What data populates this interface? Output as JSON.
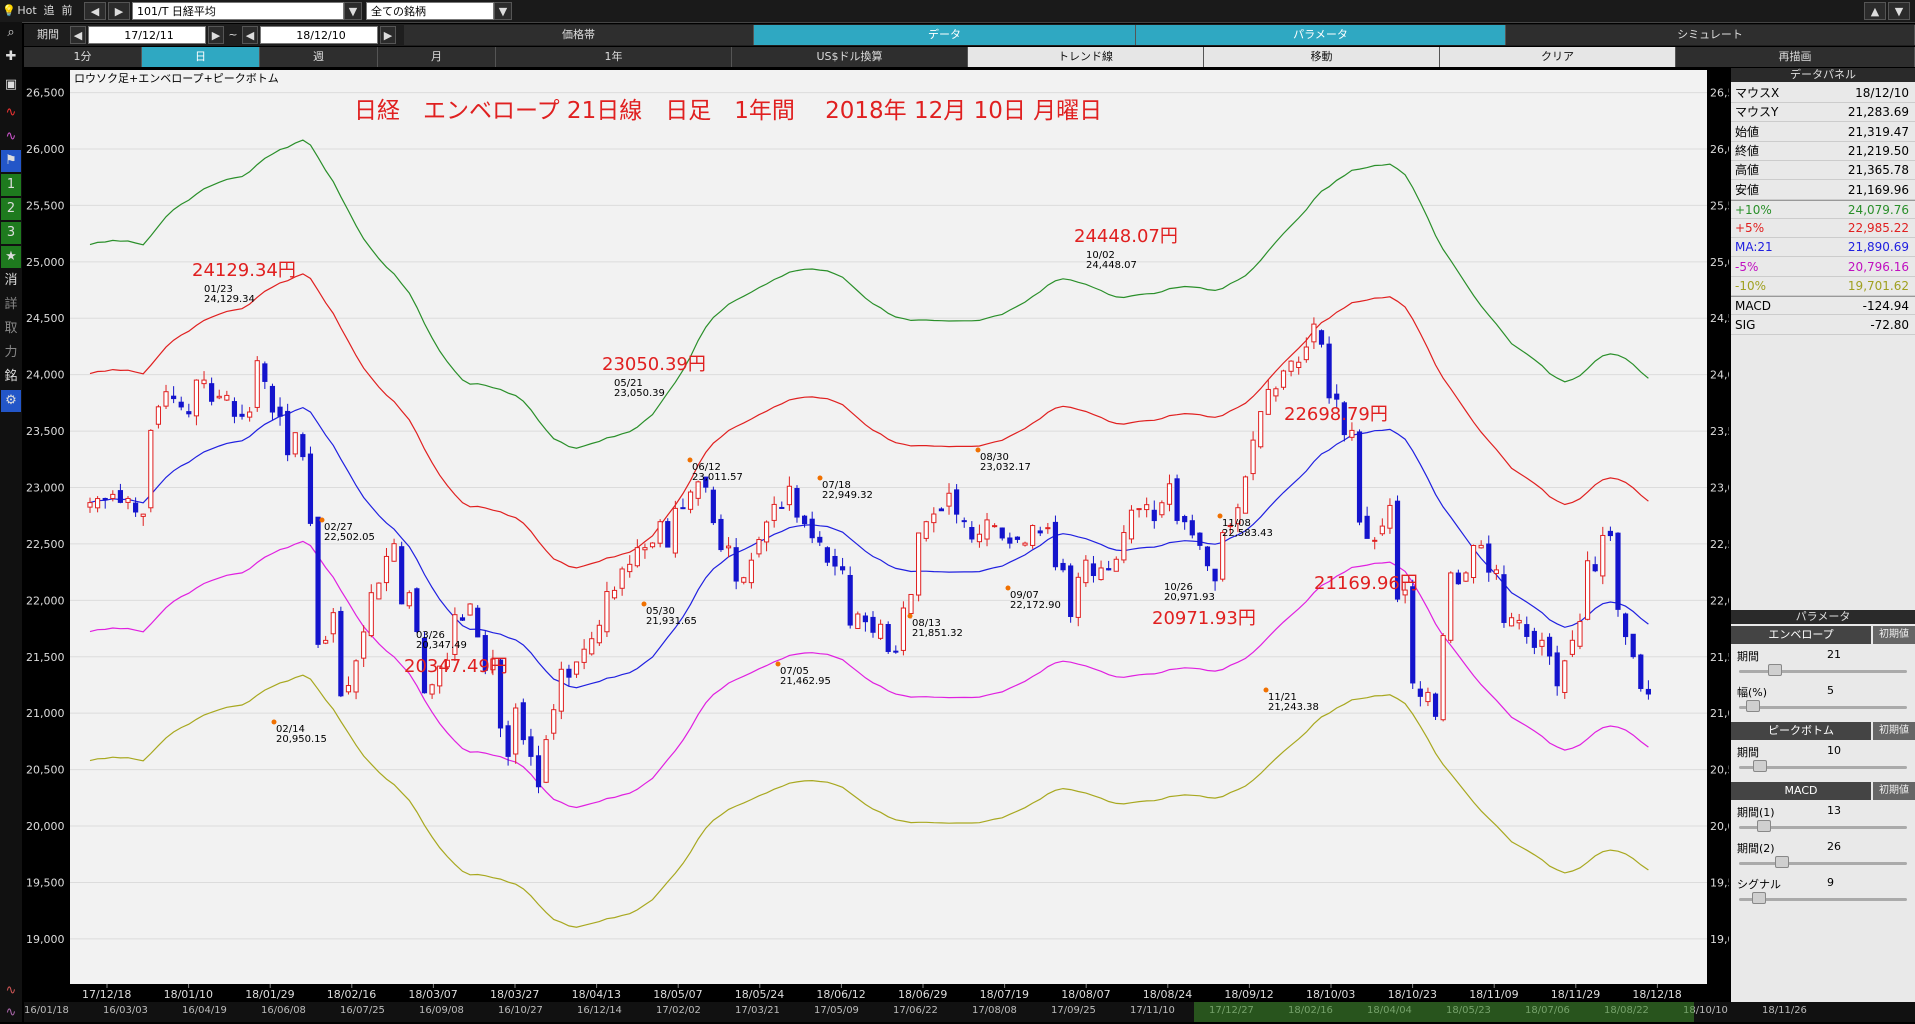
{
  "topbar": {
    "hot": "Hot",
    "follow": "追",
    "prev": "前",
    "symbol": "101/T 日経平均",
    "universe": "全ての銘柄",
    "period_label": "期間",
    "date_from": "17/12/11",
    "date_to": "18/12/10",
    "tilde": "~",
    "tabs": [
      "価格帯",
      "データ",
      "パラメータ",
      "シミュレート"
    ]
  },
  "tabs2": [
    "1分",
    "日",
    "週",
    "月",
    "1年",
    "US$ドル換算",
    "トレンド線",
    "移動",
    "クリア",
    "再描画"
  ],
  "left_toolbar": [
    "search-icon",
    "plus-icon",
    "camera-icon",
    "chart-red-icon",
    "chart-purple-icon",
    "flag-icon",
    "1",
    "2",
    "3",
    "★",
    "消",
    "詳",
    "取",
    "力",
    "銘",
    "gear-icon"
  ],
  "chart": {
    "subtitle": "ロウソク足+エンベロープ+ピークボトム",
    "title": "日経　エンベロープ 21日線　日足　1年間　 2018年 12月 10日 月曜日",
    "peak_labels": [
      {
        "text": "24129.34円",
        "date": "01/23",
        "value": "24,129.34",
        "kind": "peak"
      },
      {
        "text": "20347.49円",
        "date": "03/26",
        "value": "20,347.49",
        "kind": "bottom"
      },
      {
        "text": "23050.39円",
        "date": "05/21",
        "value": "23,050.39",
        "kind": "peak"
      },
      {
        "text": "24448.07円",
        "date": "10/02",
        "value": "24,448.07",
        "kind": "peak"
      },
      {
        "text": "20971.93円",
        "date": "10/26",
        "value": "20,971.93",
        "kind": "bottom"
      },
      {
        "text": "22698.79円",
        "date": "",
        "value": "",
        "kind": "peak"
      },
      {
        "text": "21169.96円",
        "date": "",
        "value": "",
        "kind": "last"
      }
    ],
    "small_labels": [
      {
        "date": "02/14",
        "value": "20,950.15"
      },
      {
        "date": "02/27",
        "value": "22,502.05"
      },
      {
        "date": "05/30",
        "value": "21,931.65"
      },
      {
        "date": "06/12",
        "value": "23,011.57"
      },
      {
        "date": "07/05",
        "value": "21,462.95"
      },
      {
        "date": "07/18",
        "value": "22,949.32"
      },
      {
        "date": "08/13",
        "value": "21,851.32"
      },
      {
        "date": "08/30",
        "value": "23,032.17"
      },
      {
        "date": "09/07",
        "value": "22,172.90"
      },
      {
        "date": "11/08",
        "value": "22,583.43"
      },
      {
        "date": "11/21",
        "value": "21,243.38"
      }
    ],
    "x_ticks": [
      "17/12/18",
      "18/01/10",
      "18/01/29",
      "18/02/16",
      "18/03/07",
      "18/03/27",
      "18/04/13",
      "18/05/07",
      "18/05/24",
      "18/06/12",
      "18/06/29",
      "18/07/19",
      "18/08/07",
      "18/08/24",
      "18/09/12",
      "18/10/03",
      "18/10/23",
      "18/11/09",
      "18/11/29",
      "18/12/18"
    ],
    "y_ticks": [
      "26,500",
      "26,000",
      "25,500",
      "25,000",
      "24,500",
      "24,000",
      "23,500",
      "23,000",
      "22,500",
      "22,000",
      "21,500",
      "21,000",
      "20,500",
      "20,000",
      "19,500",
      "19,000"
    ]
  },
  "chart_data": {
    "type": "candlestick",
    "title": "日経　エンベロープ 21日線　日足　1年間",
    "ylim": [
      18600,
      26700
    ],
    "ohlc": [],
    "seed_closes": [
      22866,
      22902,
      22892,
      22939,
      22868,
      22903,
      22783,
      22764,
      23506,
      23715,
      23849,
      23788,
      23714,
      23653,
      23952,
      23952,
      23764,
      23808,
      23816,
      23631,
      23631,
      23669,
      24124,
      23940,
      23669,
      23631,
      23291,
      23486,
      23274,
      22682,
      21610,
      21645,
      21891,
      21154,
      21245,
      21464,
      21720,
      22068,
      22153,
      22389,
      22502,
      21969,
      22068,
      21724,
      21181,
      21252,
      21417,
      21469,
      21873,
      21824,
      21968,
      21676,
      21380,
      21480,
      20869,
      20617,
      21046,
      20766,
      20617,
      20348,
      20766,
      21031,
      21389,
      21319,
      21454,
      21567,
      21660,
      21779,
      22078,
      22088,
      22278,
      22319,
      22467,
      22467,
      22508,
      22697,
      22472,
      22815,
      22818,
      22960,
      23050,
      23003,
      22689,
      22450,
      22481,
      22171,
      22201,
      22356,
      22539,
      22694,
      22850,
      22823,
      23011,
      22738,
      22680,
      22555,
      22516,
      22338,
      22304,
      22270,
      21781,
      21879,
      21811,
      21717,
      21788,
      21547,
      21546,
      21932,
      22052,
      22597,
      22697,
      22765,
      22794,
      22949,
      22764,
      22698,
      22544,
      22586,
      22713,
      22662,
      22553,
      22507,
      22540,
      22507,
      22663,
      22598,
      22644,
      22298,
      22271,
      21857,
      22204,
      22356,
      22220,
      22287,
      22270,
      22364,
      22601,
      22799,
      22813,
      22848,
      22707,
      22865,
      23033,
      22708,
      22697,
      22580,
      22487,
      22307,
      22173,
      22600,
      22664,
      22821,
      23094,
      23420,
      23673,
      23869,
      23875,
      24033,
      24120,
      24110,
      24245,
      24448,
      24270,
      23795,
      23783,
      23469,
      23506,
      22694,
      22549,
      22532,
      22658,
      22841,
      22011,
      22091,
      21268,
      21149,
      21184,
      20972,
      21688,
      22243,
      22147,
      22243,
      22486,
      22487,
      22250,
      22270,
      21804,
      21846,
      21822,
      21680,
      21583,
      21646,
      21507,
      21243,
      21464,
      21646,
      21812,
      22351,
      22262,
      22575,
      22574,
      21920,
      21679,
      21501,
      21219,
      21170
    ],
    "legend": [
      "+10%",
      "+5%",
      "MA:21",
      "-5%",
      "-10%"
    ],
    "series_colors": {
      "plus10": "#2a8f2a",
      "plus5": "#e02020",
      "ma": "#2020e0",
      "minus5": "#e020e0",
      "minus10": "#a8a820",
      "up": "#e02020",
      "down": "#1414cc"
    }
  },
  "panel": {
    "header": "データパネル",
    "rows": [
      {
        "k": "マウスX",
        "v": "18/12/10",
        "c": "#000"
      },
      {
        "k": "マウスY",
        "v": "21,283.69",
        "c": "#000"
      },
      {
        "k": "始値",
        "v": "21,319.47",
        "c": "#000"
      },
      {
        "k": "終値",
        "v": "21,219.50",
        "c": "#000"
      },
      {
        "k": "高値",
        "v": "21,365.78",
        "c": "#000"
      },
      {
        "k": "安値",
        "v": "21,169.96",
        "c": "#000"
      },
      {
        "k": "+10%",
        "v": "24,079.76",
        "c": "#2a8f2a"
      },
      {
        "k": "+5%",
        "v": "22,985.22",
        "c": "#e02020"
      },
      {
        "k": "MA:21",
        "v": "21,890.69",
        "c": "#2020e0"
      },
      {
        "k": "-5%",
        "v": "20,796.16",
        "c": "#c010c0"
      },
      {
        "k": "-10%",
        "v": "19,701.62",
        "c": "#a0a020"
      },
      {
        "k": "MACD",
        "v": "-124.94",
        "c": "#000"
      },
      {
        "k": "SIG",
        "v": "-72.80",
        "c": "#000"
      }
    ],
    "param_header": "パラメータ",
    "sections": [
      {
        "label": "エンベロープ",
        "reset": "初期値",
        "params": [
          {
            "k": "期間",
            "v": "21"
          },
          {
            "k": "幅(%)",
            "v": "5"
          }
        ]
      },
      {
        "label": "ピークボトム",
        "reset": "初期値",
        "params": [
          {
            "k": "期間",
            "v": "10"
          }
        ]
      },
      {
        "label": "MACD",
        "reset": "初期値",
        "params": [
          {
            "k": "期間(1)",
            "v": "13"
          },
          {
            "k": "期間(2)",
            "v": "26"
          },
          {
            "k": "シグナル",
            "v": "9"
          }
        ]
      }
    ]
  },
  "bottom_ticks": [
    "16/01/18",
    "16/03/03",
    "16/04/19",
    "16/06/08",
    "16/07/25",
    "16/09/08",
    "16/10/27",
    "16/12/14",
    "17/02/02",
    "17/03/21",
    "17/05/09",
    "17/06/22",
    "17/08/08",
    "17/09/25",
    "17/11/10",
    "17/12/27",
    "18/02/16",
    "18/04/04",
    "18/05/23",
    "18/07/06",
    "18/08/22",
    "18/10/10",
    "18/11/26"
  ]
}
